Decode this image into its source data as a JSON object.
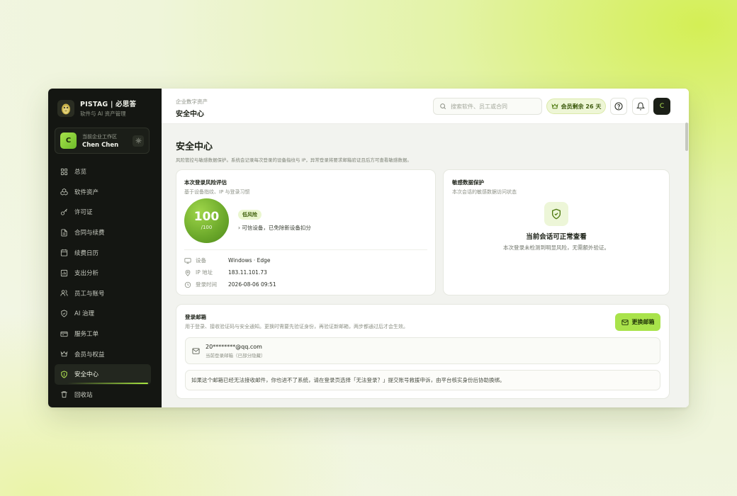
{
  "brand": {
    "name": "PISTAG | 必思答",
    "subtitle": "软件与 AI 资产管理"
  },
  "workspace": {
    "label": "当前企业工作区",
    "name": "Chen Chen",
    "avatar": "C"
  },
  "sidebar": {
    "items": [
      {
        "label": "总览",
        "icon": "grid-icon"
      },
      {
        "label": "软件资产",
        "icon": "cubes-icon"
      },
      {
        "label": "许可证",
        "icon": "key-icon"
      },
      {
        "label": "合同与续费",
        "icon": "document-icon"
      },
      {
        "label": "续费日历",
        "icon": "calendar-icon"
      },
      {
        "label": "支出分析",
        "icon": "chart-icon"
      },
      {
        "label": "员工与账号",
        "icon": "users-icon"
      },
      {
        "label": "AI 治理",
        "icon": "shield-check-icon"
      },
      {
        "label": "服务工单",
        "icon": "ticket-icon"
      },
      {
        "label": "会员与权益",
        "icon": "crown-icon"
      },
      {
        "label": "安全中心",
        "icon": "shield-icon",
        "active": true
      },
      {
        "label": "回收站",
        "icon": "trash-icon"
      }
    ]
  },
  "header": {
    "breadcrumb": "企业数字资产",
    "title": "安全中心",
    "search_placeholder": "搜索软件、员工或合同",
    "membership": "会员剩余 26 天",
    "user_avatar": "C"
  },
  "page": {
    "title": "安全中心",
    "description": "风险管控与敏感数据保护。系统会记录每次登录的设备指纹与 IP，异常登录将要求邮箱验证且后方可查看敏感数据。"
  },
  "risk_card": {
    "title": "本次登录风险评估",
    "subtitle": "基于设备指纹、IP 与登录习惯",
    "score": "100",
    "score_max": "/100",
    "level": "低风险",
    "note": "› 可信设备，已免除新设备扣分",
    "meta": [
      {
        "key": "设备",
        "value": "Windows · Edge",
        "icon": "monitor-icon"
      },
      {
        "key": "IP 地址",
        "value": "183.11.101.73",
        "icon": "location-icon"
      },
      {
        "key": "登录时间",
        "value": "2026-08-06 09:51",
        "icon": "clock-icon"
      }
    ]
  },
  "sensitive_card": {
    "title": "敏感数据保护",
    "subtitle": "本次会话的敏感数据访问状态",
    "status_title": "当前会话可正常查看",
    "status_desc": "本次登录未检测到明显风险，无需额外验证。"
  },
  "email_card": {
    "title": "登录邮箱",
    "subtitle": "用于登录、接收验证码与安全通知。更换时需要先验证身份，再验证新邮箱，两步都通过后才会生效。",
    "button": "更换邮箱",
    "email": "20********@qq.com",
    "email_note": "当前登录邮箱（已部分隐藏）",
    "notice": "如果这个邮箱已经无法接收邮件，你也进不了系统，请在登录页选择「无法登录？」提交账号救援申诉，由平台核实身份后协助换绑。"
  },
  "colors": {
    "accent": "#a9e34b",
    "sidebar_bg": "#141612",
    "score_green": "#6ba82a"
  }
}
